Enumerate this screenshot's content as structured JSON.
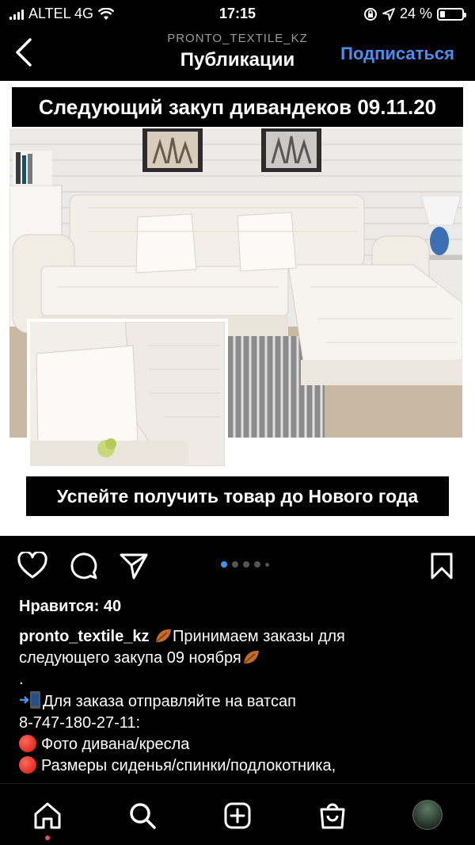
{
  "status_bar": {
    "carrier": "ALTEL 4G",
    "time": "17:15",
    "battery": "24 %",
    "battery_level": 0.24
  },
  "header": {
    "username": "PRONTO_TEXTILE_KZ",
    "title": "Публикации",
    "follow_label": "Подписаться",
    "accent_color": "#4a8ff0"
  },
  "post": {
    "banner_top": "Следующий закуп дивандеков 09.11.20",
    "banner_bottom": "Успейте получить товар до Нового года",
    "carousel": {
      "total": 5,
      "active": 1
    }
  },
  "icons": {
    "back": "chevron-left-icon",
    "like": "heart-icon",
    "comment": "comment-icon",
    "share": "send-icon",
    "save": "bookmark-icon",
    "home": "home-icon",
    "search": "search-icon",
    "add": "plus-square-icon",
    "shop": "shopping-bag-icon"
  },
  "likes": "Нравится: 40",
  "caption": {
    "username": "pronto_textile_kz",
    "line1_rest": "Принимаем заказы для",
    "line2": "следующего закупа 09 ноября",
    "line3": ".",
    "line4": "Для заказа отправляйте на ватсап",
    "line5": "8-747-180-27-11:",
    "line6": "Фото дивана/кресла",
    "line7": "Размеры сиденья/спинки/подлокотника,"
  }
}
